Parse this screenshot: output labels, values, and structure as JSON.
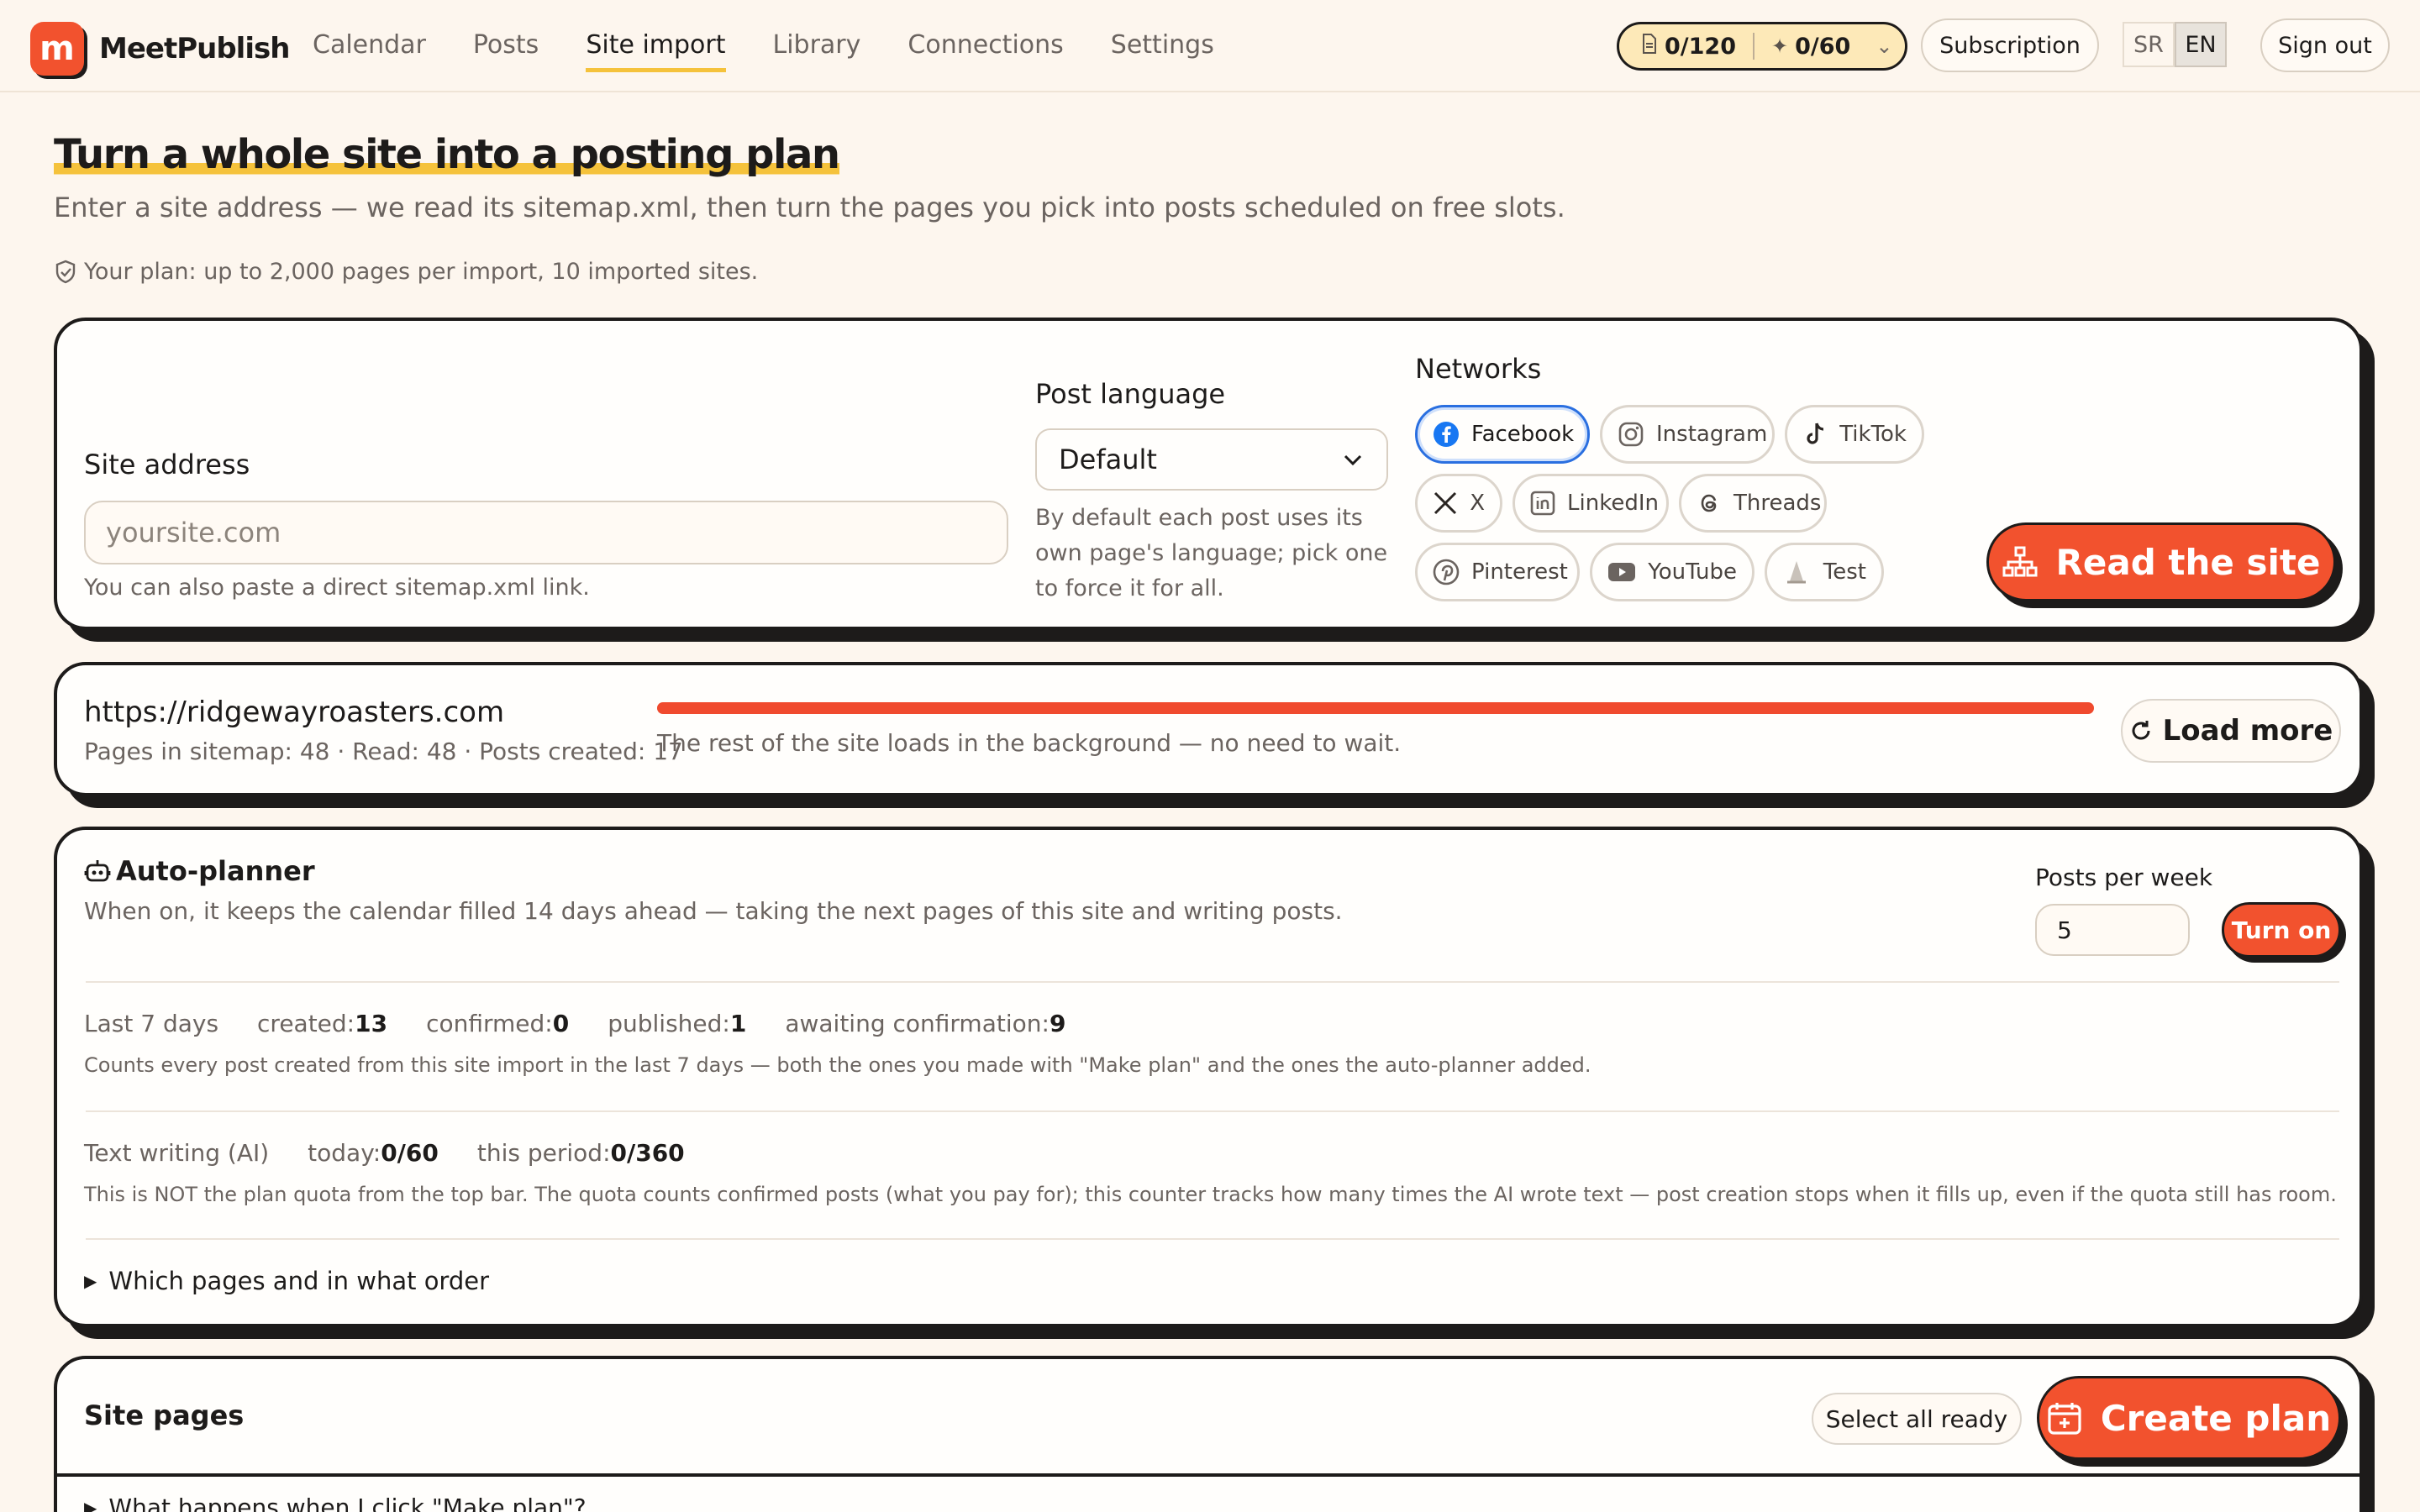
{
  "brand": {
    "logo_letter": "m",
    "name": "MeetPublish"
  },
  "nav": {
    "items": [
      "Calendar",
      "Posts",
      "Site import",
      "Library",
      "Connections",
      "Settings"
    ],
    "active": "Site import"
  },
  "header": {
    "quota_posts": "0/120",
    "quota_ai": "0/60",
    "subscription": "Subscription",
    "lang_sr": "SR",
    "lang_en": "EN",
    "sign_out": "Sign out"
  },
  "hero": {
    "title": "Turn a whole site into a posting plan",
    "subtitle": "Enter a site address — we read its sitemap.xml, then turn the pages you pick into posts scheduled on free slots.",
    "plan": "Your plan: up to 2,000 pages per import, 10 imported sites."
  },
  "import_form": {
    "site_label": "Site address",
    "site_placeholder": "yoursite.com",
    "site_hint": "You can also paste a direct sitemap.xml link.",
    "lang_label": "Post language",
    "lang_value": "Default",
    "lang_hint_1": "By default each post uses its",
    "lang_hint_2": "own page's language; pick one",
    "lang_hint_3": "to force it for all.",
    "networks_label": "Networks",
    "networks": [
      "Facebook",
      "Instagram",
      "TikTok",
      "X",
      "LinkedIn",
      "Threads",
      "Pinterest",
      "YouTube",
      "Test"
    ],
    "read_button": "Read the site"
  },
  "site": {
    "url": "https://ridgewayroasters.com",
    "stats": "Pages in sitemap: 48 · Read: 48 · Posts created: 17",
    "progress": 1.0,
    "bg_note": "The rest of the site loads in the background — no need to wait.",
    "load_more": "Load more"
  },
  "autoplanner": {
    "title": "Auto-planner",
    "desc": "When on, it keeps the calendar filled 14 days ahead — taking the next pages of this site and writing posts.",
    "ppw_label": "Posts per week",
    "ppw_value": "5",
    "turn_on": "Turn on",
    "last7_label": "Last 7 days",
    "created_label": "created:",
    "created_value": "13",
    "confirmed_label": "confirmed:",
    "confirmed_value": "0",
    "published_label": "published:",
    "published_value": "1",
    "awaiting_label": "awaiting confirmation:",
    "awaiting_value": "9",
    "last7_note": "Counts every post created from this site import in the last 7 days — both the ones you made with \"Make plan\" and the ones the auto-planner added.",
    "ai_label": "Text writing (AI)",
    "today_label": "today:",
    "today_value": "0/60",
    "period_label": "this period:",
    "period_value": "0/360",
    "ai_note": "This is NOT the plan quota from the top bar. The quota counts confirmed posts (what you pay for); this counter tracks how many times the AI wrote text — post creation stops when it fills up, even if the quota still has room.",
    "order_toggle": "Which pages and in what order"
  },
  "pages": {
    "title": "Site pages",
    "select_all": "Select all ready",
    "create_plan": "Create plan",
    "faq": "What happens when I click \"Make plan\"?"
  },
  "colors": {
    "accent": "#f2522e",
    "highlight": "#f5c23b",
    "ink": "#1d1b1a",
    "bg": "#fdf6ee",
    "facebook": "#1877f2"
  }
}
